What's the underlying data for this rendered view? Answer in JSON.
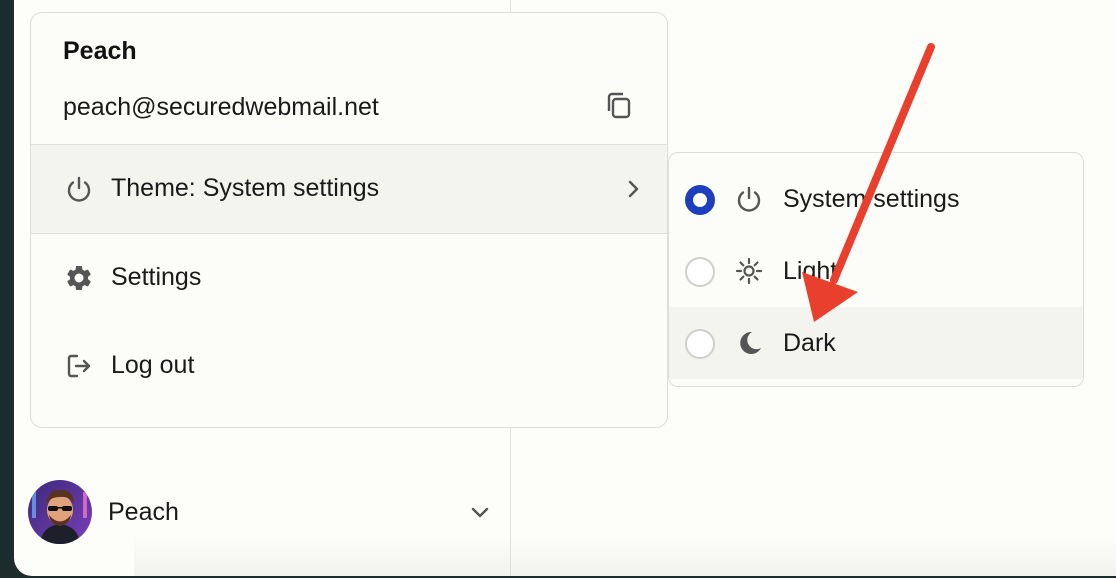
{
  "user_menu": {
    "name": "Peach",
    "email": "peach@securedwebmail.net",
    "copy_icon": "copy-icon",
    "theme_label": "Theme: System settings",
    "theme_icon": "power-icon",
    "theme_chevron_icon": "chevron-right-icon",
    "items": [
      {
        "label": "Settings",
        "icon": "gear-icon"
      },
      {
        "label": "Log out",
        "icon": "logout-icon"
      }
    ]
  },
  "theme_submenu": {
    "options": [
      {
        "label": "System settings",
        "icon": "power-icon",
        "selected": true
      },
      {
        "label": "Light",
        "icon": "sun-icon",
        "selected": false
      },
      {
        "label": "Dark",
        "icon": "moon-icon",
        "selected": false
      }
    ]
  },
  "profile": {
    "name": "Peach",
    "chevron_icon": "chevron-down-icon"
  },
  "colors": {
    "accent": "#1d3fbf",
    "annotation_arrow": "#e8402d"
  }
}
